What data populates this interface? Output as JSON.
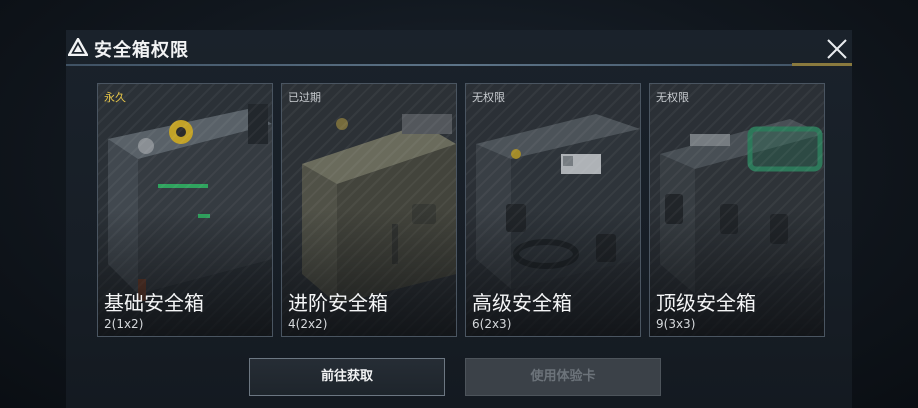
{
  "dialog": {
    "title": "安全箱权限",
    "close_icon": "close-icon",
    "title_icon": "warning-triangle-icon"
  },
  "cards": [
    {
      "status": "永久",
      "name": "基础安全箱",
      "size": "2(1x2)"
    },
    {
      "status": "已过期",
      "name": "进阶安全箱",
      "size": "4(2x2)"
    },
    {
      "status": "无权限",
      "name": "高级安全箱",
      "size": "6(2x3)"
    },
    {
      "status": "无权限",
      "name": "顶级安全箱",
      "size": "9(3x3)"
    }
  ],
  "buttons": {
    "acquire": "前往获取",
    "use_trial": "使用体验卡"
  },
  "colors": {
    "accent_status": "#e6c64a",
    "card_border": "#4a5561",
    "title_line": "#5d7488"
  }
}
